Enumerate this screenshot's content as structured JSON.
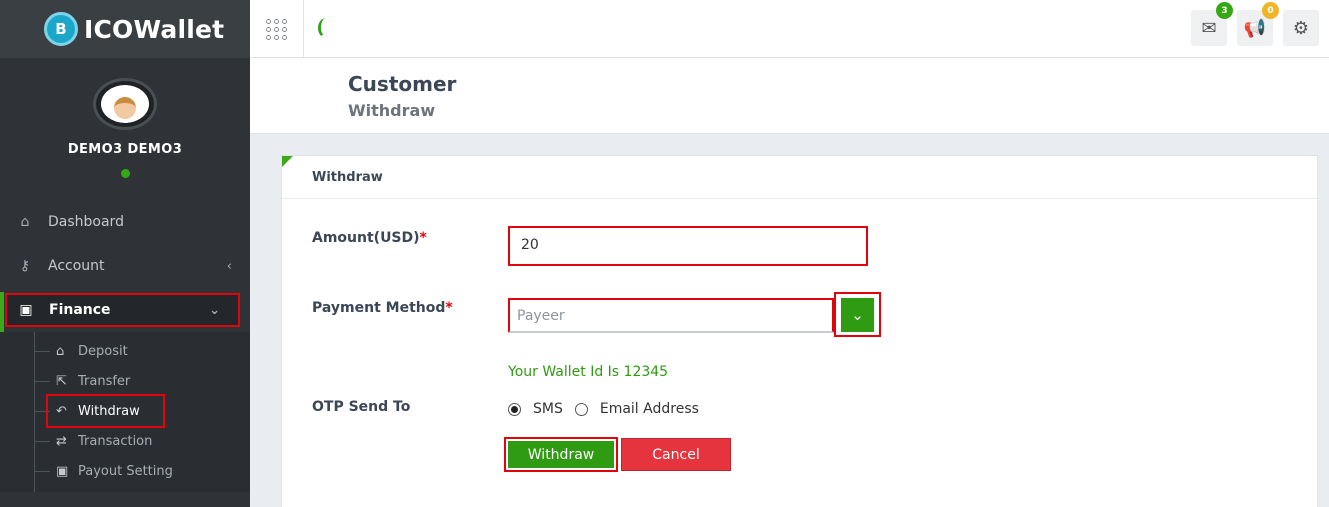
{
  "brand": {
    "logo_glyph": "B",
    "name_prefix": "ICO",
    "name_suffix": "Wallet"
  },
  "user": {
    "name": "DEMO3 DEMO3",
    "status": "online"
  },
  "sidebar": {
    "items": [
      {
        "label": "Dashboard",
        "icon": "home-icon"
      },
      {
        "label": "Account",
        "icon": "key-icon"
      },
      {
        "label": "Finance",
        "icon": "money-icon"
      }
    ],
    "finance_sub": [
      {
        "label": "Deposit",
        "icon": "bank-icon"
      },
      {
        "label": "Transfer",
        "icon": "share-icon"
      },
      {
        "label": "Withdraw",
        "icon": "reply-icon"
      },
      {
        "label": "Transaction",
        "icon": "exchange-icon"
      },
      {
        "label": "Payout Setting",
        "icon": "money-icon"
      }
    ]
  },
  "topbar": {
    "mail_count": "3",
    "announce_count": "0",
    "mail_badge_color": "#35a814",
    "announce_badge_color": "#f0b429"
  },
  "header": {
    "title": "Customer",
    "subtitle": "Withdraw"
  },
  "card": {
    "title": "Withdraw",
    "amount_label": "Amount(USD)",
    "amount_value": "20",
    "payment_label": "Payment Method",
    "payment_value": "Payeer",
    "wallet_note": "Your Wallet Id Is 12345",
    "otp_label": "OTP Send To",
    "otp_options": [
      {
        "label": "SMS",
        "selected": true
      },
      {
        "label": "Email Address",
        "selected": false
      }
    ],
    "submit_label": "Withdraw",
    "cancel_label": "Cancel",
    "required_mark": "*"
  },
  "colors": {
    "accent_green": "#2f9b12",
    "highlight_red": "#e0050d",
    "cancel_red": "#e5343d",
    "sidebar_bg": "#2f3337"
  }
}
